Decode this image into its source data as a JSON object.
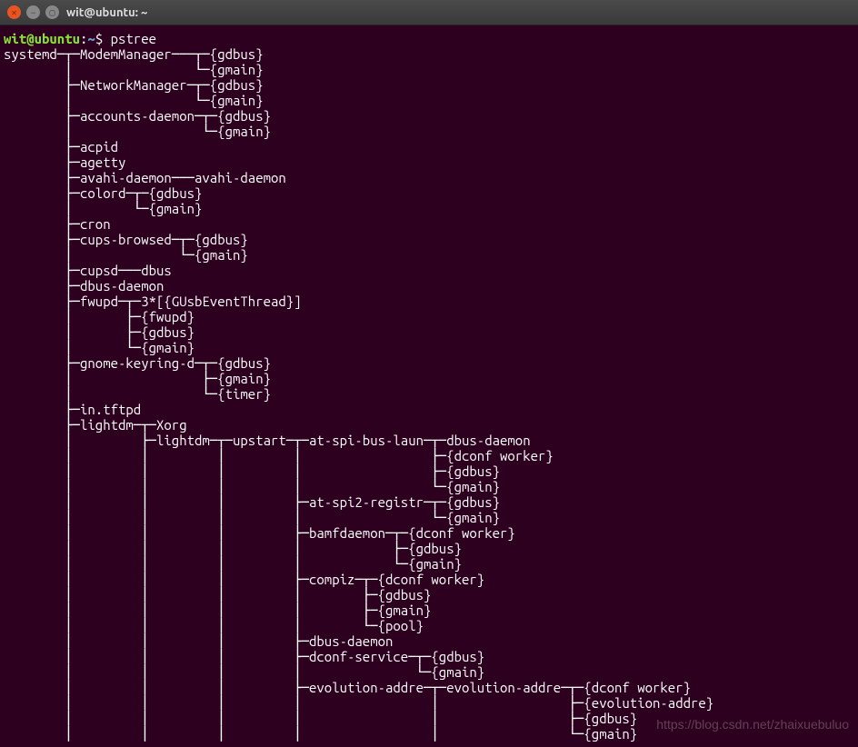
{
  "window": {
    "title": "wit@ubuntu: ~"
  },
  "prompt": {
    "user_host": "wit@ubuntu",
    "colon": ":",
    "path": "~",
    "dollar": "$ "
  },
  "command": "pstree",
  "output_lines": [
    "systemd─┬─ModemManager───┬─{gdbus}",
    "        │                └─{gmain}",
    "        ├─NetworkManager─┬─{gdbus}",
    "        │                └─{gmain}",
    "        ├─accounts-daemon─┬─{gdbus}",
    "        │                 └─{gmain}",
    "        ├─acpid",
    "        ├─agetty",
    "        ├─avahi-daemon───avahi-daemon",
    "        ├─colord─┬─{gdbus}",
    "        │        └─{gmain}",
    "        ├─cron",
    "        ├─cups-browsed─┬─{gdbus}",
    "        │              └─{gmain}",
    "        ├─cupsd───dbus",
    "        ├─dbus-daemon",
    "        ├─fwupd─┬─3*[{GUsbEventThread}]",
    "        │       ├─{fwupd}",
    "        │       ├─{gdbus}",
    "        │       └─{gmain}",
    "        ├─gnome-keyring-d─┬─{gdbus}",
    "        │                 ├─{gmain}",
    "        │                 └─{timer}",
    "        ├─in.tftpd",
    "        ├─lightdm─┬─Xorg",
    "        │         ├─lightdm─┬─upstart─┬─at-spi-bus-laun─┬─dbus-daemon",
    "        │         │         │         │                 ├─{dconf worker}",
    "        │         │         │         │                 ├─{gdbus}",
    "        │         │         │         │                 └─{gmain}",
    "        │         │         │         ├─at-spi2-registr─┬─{gdbus}",
    "        │         │         │         │                 └─{gmain}",
    "        │         │         │         ├─bamfdaemon─┬─{dconf worker}",
    "        │         │         │         │            ├─{gdbus}",
    "        │         │         │         │            └─{gmain}",
    "        │         │         │         ├─compiz─┬─{dconf worker}",
    "        │         │         │         │        ├─{gdbus}",
    "        │         │         │         │        ├─{gmain}",
    "        │         │         │         │        └─{pool}",
    "        │         │         │         ├─dbus-daemon",
    "        │         │         │         ├─dconf-service─┬─{gdbus}",
    "        │         │         │         │               └─{gmain}",
    "        │         │         │         ├─evolution-addre─┬─evolution-addre─┬─{dconf worker}",
    "        │         │         │         │                 │                 ├─{evolution-addre}",
    "        │         │         │         │                 │                 ├─{gdbus}",
    "        │         │         │         │                 │                 └─{gmain}"
  ],
  "watermark": "https://blog.csdn.net/zhaixuebuluo"
}
